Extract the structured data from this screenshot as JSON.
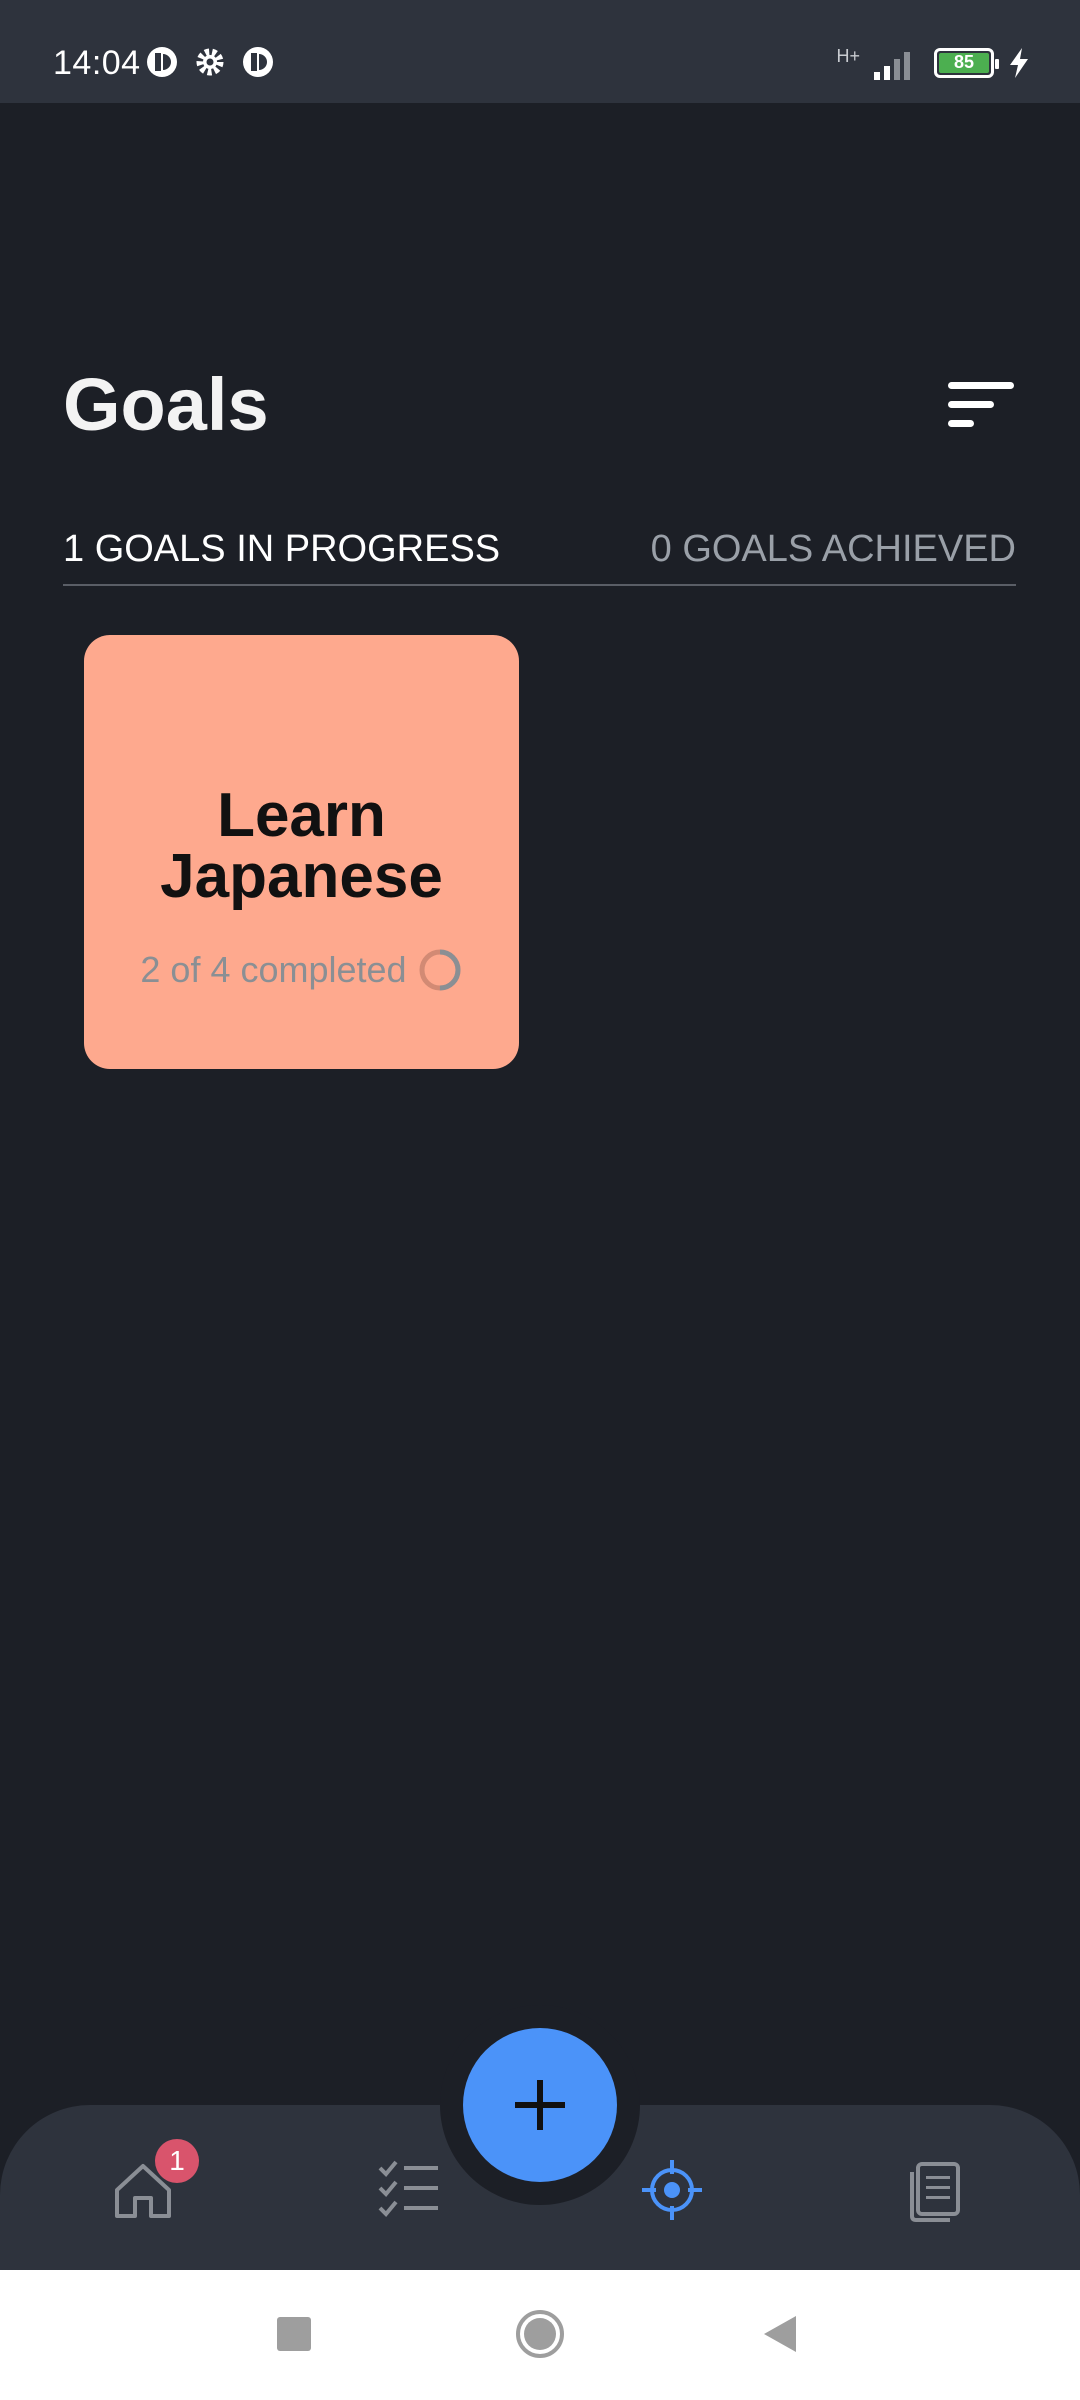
{
  "status_bar": {
    "time": "14:04",
    "network": "H+",
    "battery": "85"
  },
  "header": {
    "title": "Goals",
    "filter_icon": "sort-filter-icon"
  },
  "tabs": {
    "in_progress": "1 GOALS IN PROGRESS",
    "achieved": "0 GOALS ACHIEVED"
  },
  "goals": [
    {
      "title": "Learn Japanese",
      "progress_text": "2 of 4 completed",
      "completed": 2,
      "total": 4,
      "card_color": "#fea98e"
    }
  ],
  "bottom_nav": {
    "items": [
      {
        "icon": "home-icon",
        "badge": "1"
      },
      {
        "icon": "tasks-checklist-icon"
      },
      {
        "icon": "goals-target-icon",
        "active": true
      },
      {
        "icon": "journal-notes-icon"
      }
    ],
    "fab_icon": "plus-icon"
  },
  "colors": {
    "background": "#1c1f26",
    "surface": "#2e333d",
    "accent": "#4b93f9",
    "badge": "#d9546c"
  }
}
